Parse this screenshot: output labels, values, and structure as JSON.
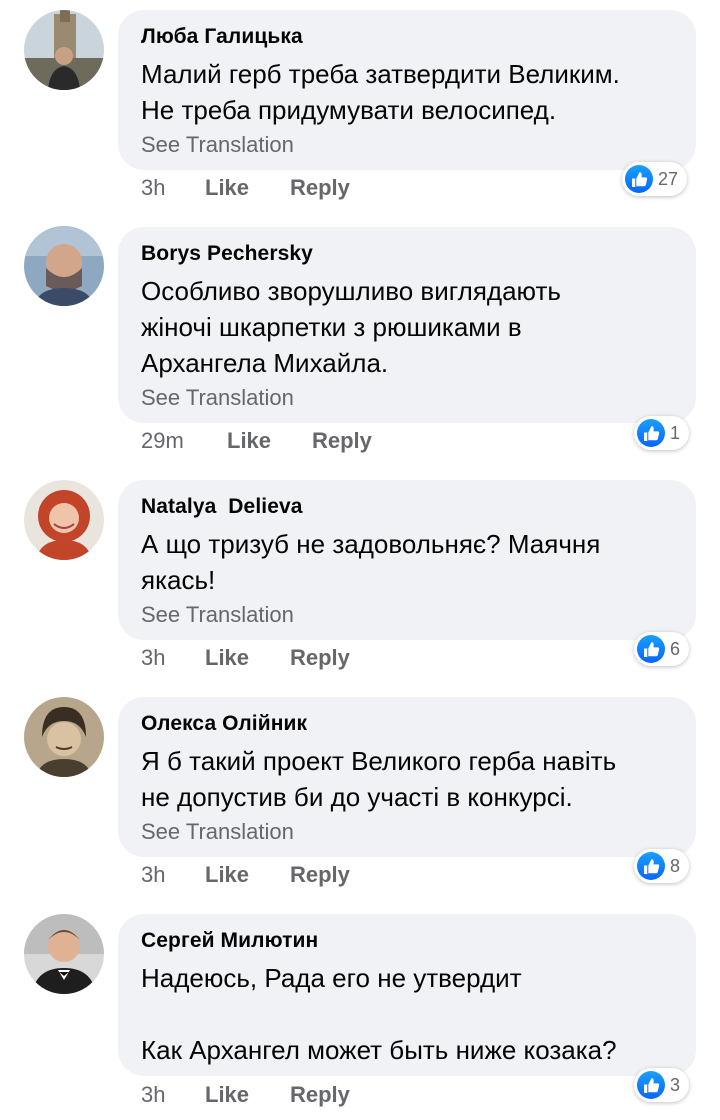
{
  "see_translation_label": "See Translation",
  "like_label": "Like",
  "reply_label": "Reply",
  "colors": {
    "bubble_bg": "#f0f2f5",
    "meta_text": "#65676b",
    "like_blue": "#0866ff"
  },
  "comments": [
    {
      "author": "Люба Галицька",
      "text": "Малий герб треба затвердити Великим.\nНе треба придумувати велосипед.",
      "time": "3h",
      "reaction_count": "27",
      "reaction_icon": "like-icon"
    },
    {
      "author": "Borys Pechersky",
      "text": "Особливо зворушливо виглядають\nжіночі шкарпетки з рюшиками в\nАрхангела Михайла.",
      "time": "29m",
      "reaction_count": "1",
      "reaction_icon": "like-icon"
    },
    {
      "author": "Natalya  Delieva",
      "text": "А що тризуб не задовольняє? Маячня\nякась!",
      "time": "3h",
      "reaction_count": "6",
      "reaction_icon": "like-icon"
    },
    {
      "author": "Олекса Олійник",
      "text": "Я б такий проект Великого герба навіть\nне допустив би до участі в конкурсі.",
      "time": "3h",
      "reaction_count": "8",
      "reaction_icon": "like-icon"
    },
    {
      "author": "Сергей Милютин",
      "text": "Надеюсь, Рада его не утвердит\n\nКак Архангел может быть ниже козака?",
      "time": "3h",
      "reaction_count": "3",
      "reaction_icon": "like-icon"
    }
  ]
}
